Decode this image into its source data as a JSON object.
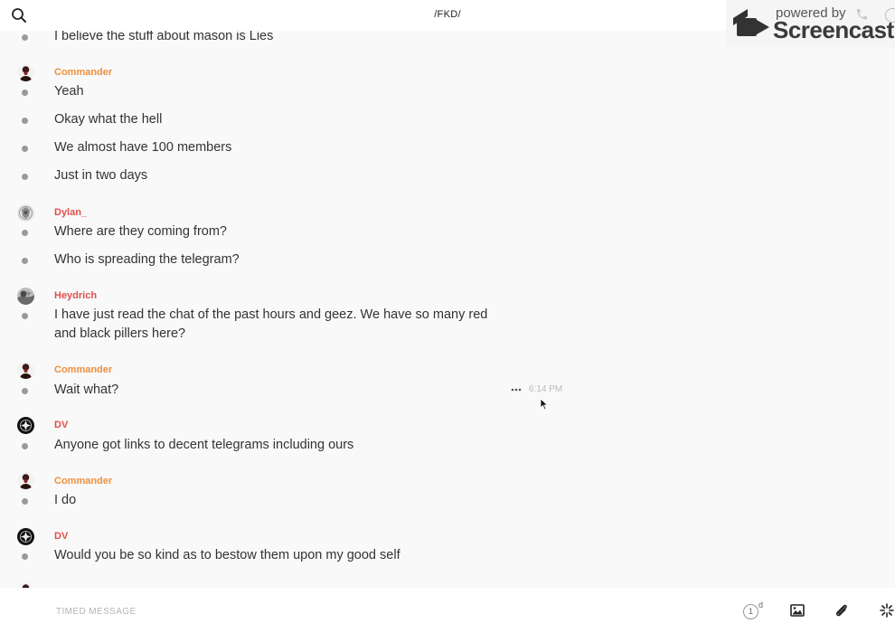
{
  "header": {
    "channel_title": "/FKD/",
    "search_icon": "search-icon"
  },
  "watermark": {
    "powered_text": "powered by",
    "brand": "Screencastify"
  },
  "messages": [
    {
      "type": "text",
      "text": "I believe the stuff about mason is Lies"
    },
    {
      "type": "author",
      "name": "Commander",
      "color": "#f0903a"
    },
    {
      "type": "text",
      "text": "Yeah"
    },
    {
      "type": "text",
      "text": "Okay what the hell"
    },
    {
      "type": "text",
      "text": "We almost have 100 members"
    },
    {
      "type": "text",
      "text": "Just in two days"
    },
    {
      "type": "author",
      "name": "Dylan_",
      "color": "#e0504a"
    },
    {
      "type": "text",
      "text": "Where are they coming from?"
    },
    {
      "type": "text",
      "text": "Who is spreading the telegram?"
    },
    {
      "type": "author",
      "name": "Heydrich",
      "color": "#e0504a"
    },
    {
      "type": "text",
      "text": "I have just read the chat of the past hours and geez. We have so many red and black pillers here?"
    },
    {
      "type": "author",
      "name": "Commander",
      "color": "#f0903a"
    },
    {
      "type": "text",
      "text": "Wait what?",
      "time": "6:14 PM"
    },
    {
      "type": "author",
      "name": "DV",
      "color": "#e0504a"
    },
    {
      "type": "text",
      "text": "Anyone got links to decent telegrams including ours"
    },
    {
      "type": "author",
      "name": "Commander",
      "color": "#f0903a"
    },
    {
      "type": "text",
      "text": "I do"
    },
    {
      "type": "author",
      "name": "DV",
      "color": "#e0504a"
    },
    {
      "type": "text",
      "text": "Would you be so kind as to bestow them upon my good self"
    }
  ],
  "composer": {
    "placeholder": "TIMED MESSAGE",
    "timer_value": "1",
    "timer_unit": "d",
    "image_icon": "image-icon",
    "attach_icon": "paperclip-icon",
    "spark_icon": "sparkle-icon"
  }
}
